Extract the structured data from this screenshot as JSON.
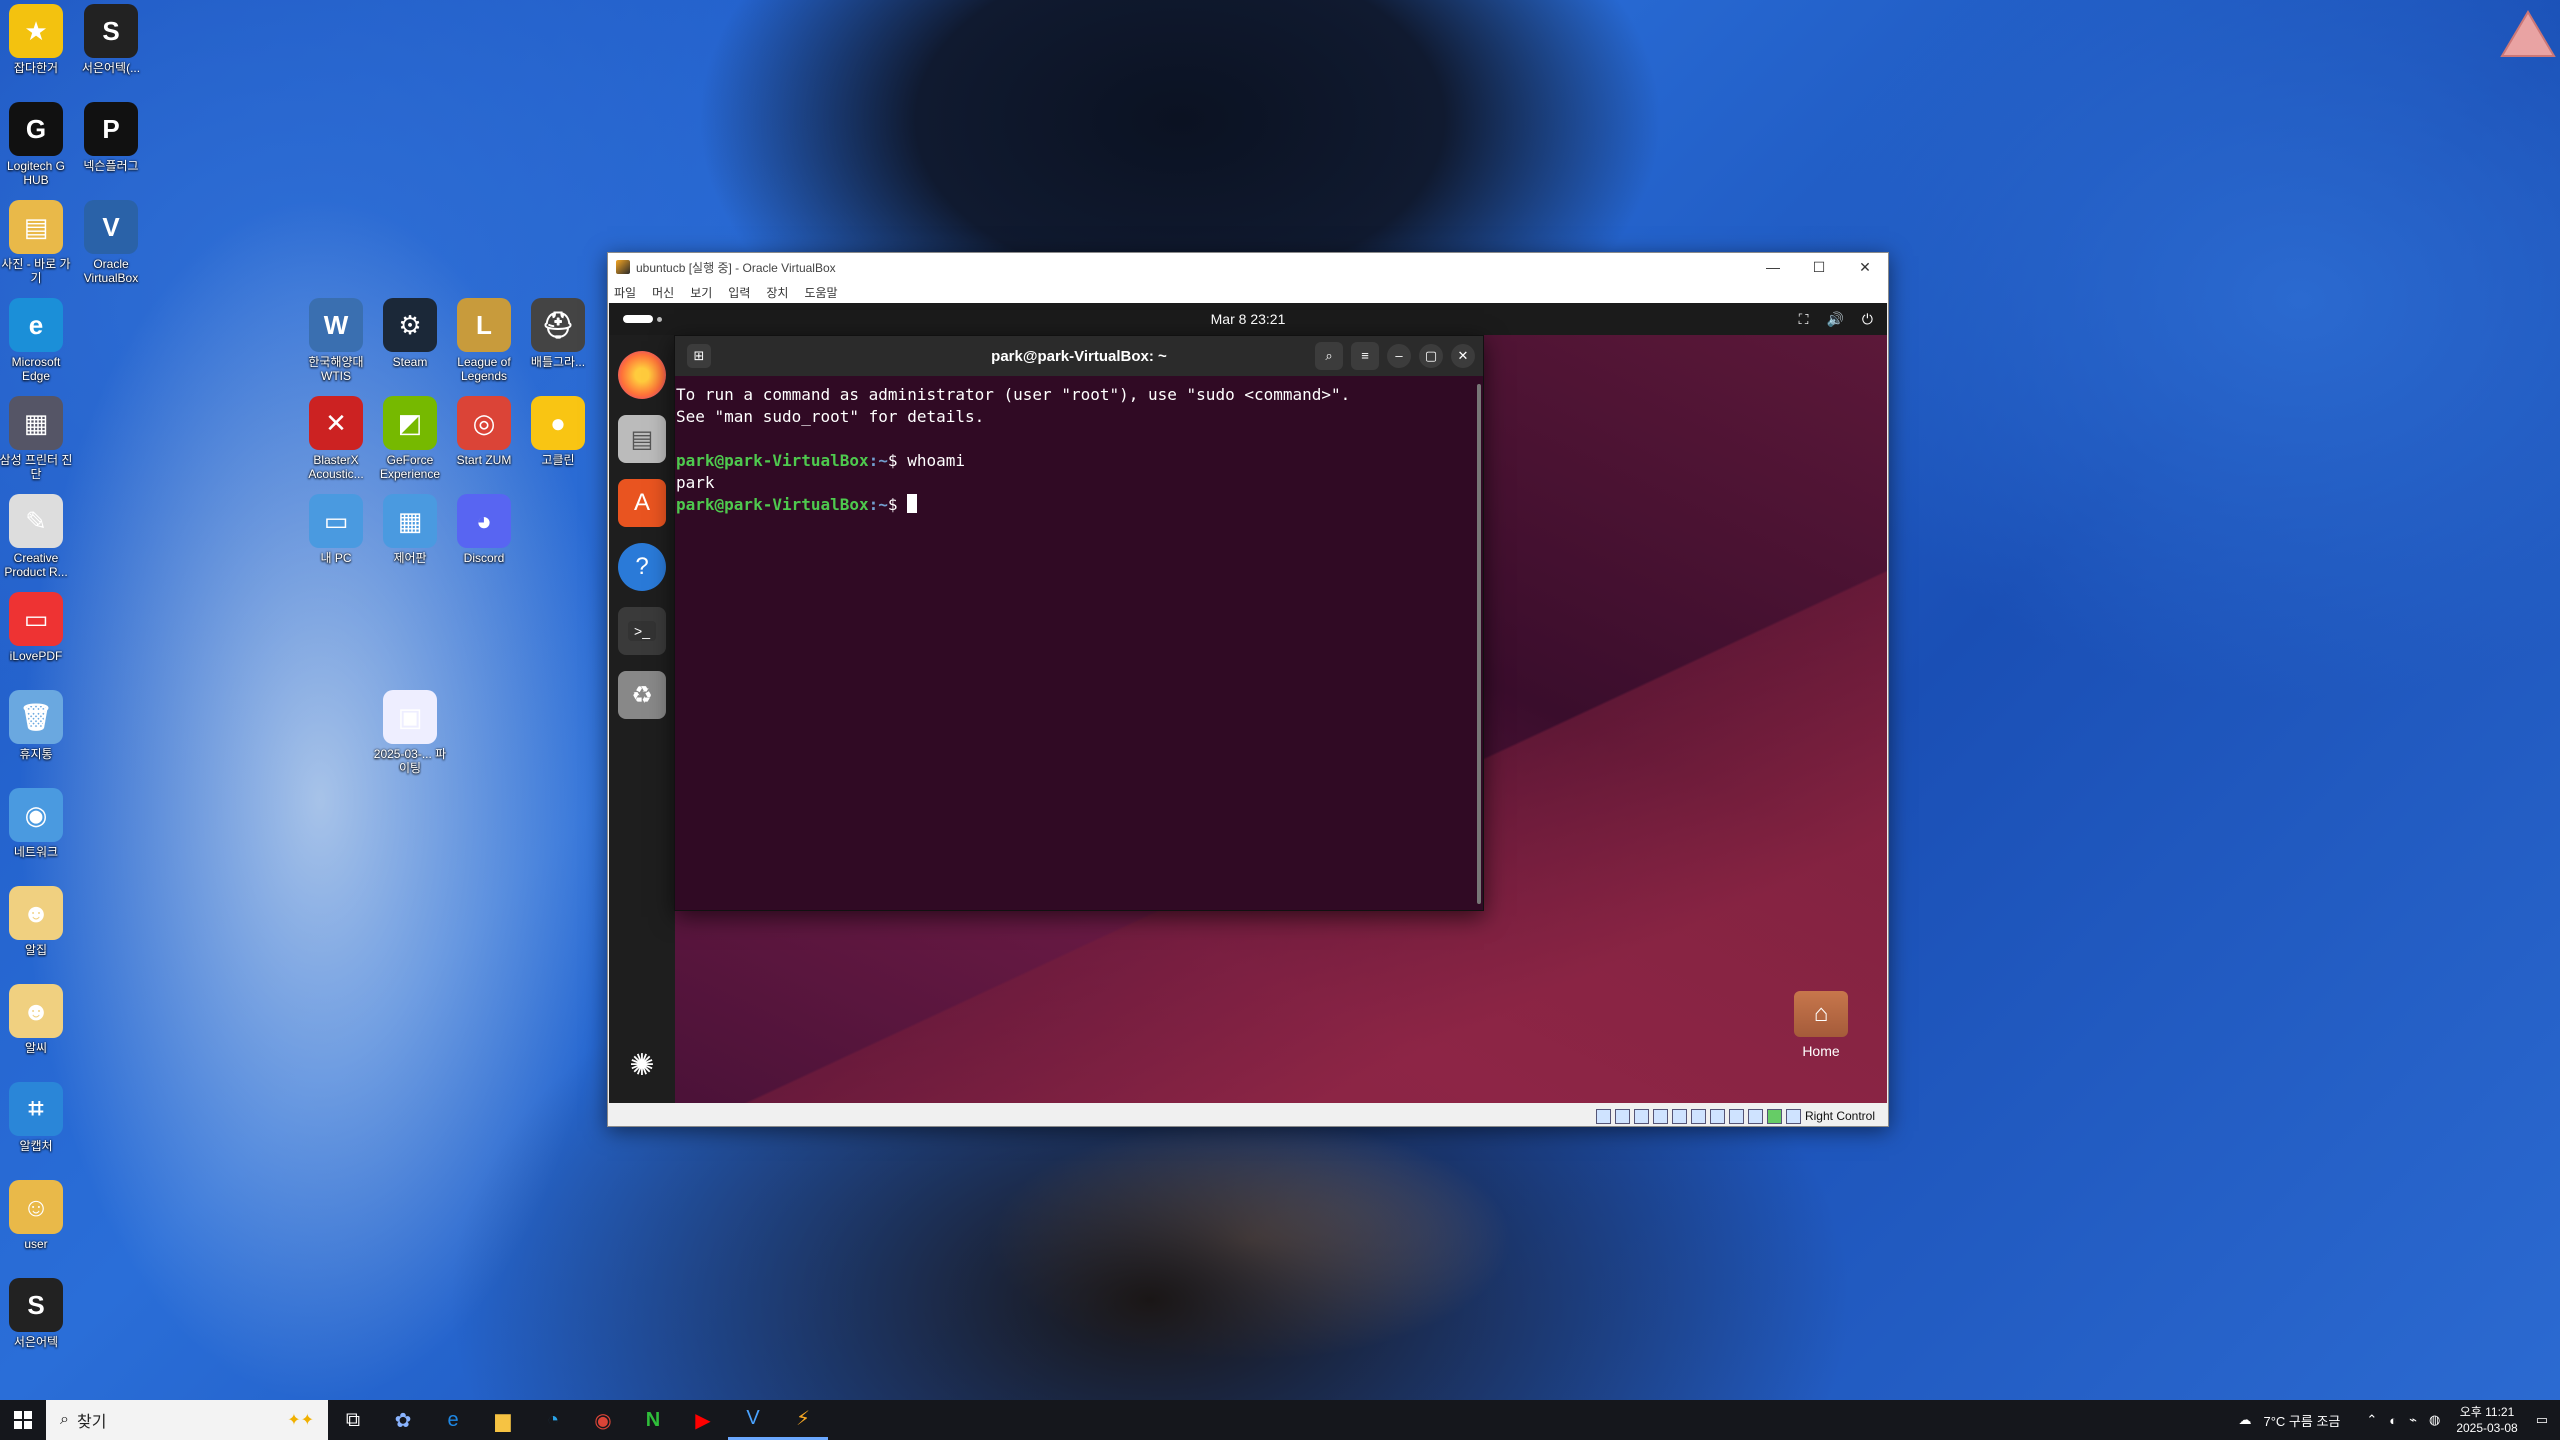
{
  "desktop": {
    "icons": [
      {
        "id": "favorites",
        "label": "잡다한거",
        "glyph": "★",
        "color": "#f3c20f"
      },
      {
        "id": "seoeun1",
        "label": "서은어텍(...",
        "glyph": "S",
        "color": "#222"
      },
      {
        "id": "logitech",
        "label": "Logitech G HUB",
        "glyph": "G",
        "color": "#111"
      },
      {
        "id": "nexon",
        "label": "넥슨플러그",
        "glyph": "P",
        "color": "#111"
      },
      {
        "id": "photos",
        "label": "사진 - 바로 가기",
        "glyph": "▤",
        "color": "#e9b949"
      },
      {
        "id": "virtualbox",
        "label": "Oracle VirtualBox",
        "glyph": "V",
        "color": "#2a62a8"
      },
      {
        "id": "edge",
        "label": "Microsoft Edge",
        "glyph": "e",
        "color": "#1b8fd8"
      },
      {
        "id": "samsung",
        "label": "삼성 프린터 진단",
        "glyph": "▦",
        "color": "#556"
      },
      {
        "id": "creative",
        "label": "Creative Product R...",
        "glyph": "✎",
        "color": "#ddd"
      },
      {
        "id": "ilovepdf",
        "label": "iLovePDF",
        "glyph": "▭",
        "color": "#e33"
      },
      {
        "id": "trash",
        "label": "휴지통",
        "glyph": "🗑",
        "color": "#6aa8e0"
      },
      {
        "id": "network",
        "label": "네트워크",
        "glyph": "◉",
        "color": "#4a9ae0"
      },
      {
        "id": "alzip",
        "label": "알집",
        "glyph": "☻",
        "color": "#f0d080"
      },
      {
        "id": "alsee",
        "label": "알씨",
        "glyph": "☻",
        "color": "#f0d080"
      },
      {
        "id": "alcapture",
        "label": "알캡처",
        "glyph": "⌗",
        "color": "#2a86d8"
      },
      {
        "id": "user",
        "label": "user",
        "glyph": "☺",
        "color": "#e9b949"
      },
      {
        "id": "seoeun2",
        "label": "서은어텍",
        "glyph": "S",
        "color": "#222"
      },
      {
        "id": "wtis",
        "label": "한국해양대 WTIS",
        "glyph": "W",
        "color": "#3a6fb0"
      },
      {
        "id": "steam",
        "label": "Steam",
        "glyph": "⚙",
        "color": "#1b2838"
      },
      {
        "id": "lol",
        "label": "League of Legends",
        "glyph": "L",
        "color": "#c89b3c"
      },
      {
        "id": "pubg",
        "label": "배틀그라...",
        "glyph": "⛑",
        "color": "#444"
      },
      {
        "id": "blasterx",
        "label": "BlasterX Acoustic...",
        "glyph": "✕",
        "color": "#c22"
      },
      {
        "id": "geforce",
        "label": "GeForce Experience",
        "glyph": "◩",
        "color": "#76b900"
      },
      {
        "id": "zum",
        "label": "Start ZUM",
        "glyph": "◎",
        "color": "#db4437"
      },
      {
        "id": "gostop",
        "label": "고클린",
        "glyph": "●",
        "color": "#f9c513"
      },
      {
        "id": "mypc",
        "label": "내 PC",
        "glyph": "▭",
        "color": "#4a9ae0"
      },
      {
        "id": "control",
        "label": "제어판",
        "glyph": "▦",
        "color": "#4a9ae0"
      },
      {
        "id": "discord",
        "label": "Discord",
        "glyph": "◕",
        "color": "#5865f2"
      },
      {
        "id": "imagefile",
        "label": "2025-03-... 파이팅",
        "glyph": "▣",
        "color": "#eef"
      }
    ]
  },
  "vbox": {
    "title": "ubuntucb [실행 중] - Oracle VirtualBox",
    "menu": [
      "파일",
      "머신",
      "보기",
      "입력",
      "장치",
      "도움말"
    ],
    "status_host_key": "Right Control"
  },
  "guest": {
    "clock": "Mar 8  23:21",
    "terminal": {
      "title": "park@park-VirtualBox: ~",
      "lines": {
        "l1": "To run a command as administrator (user \"root\"), use \"sudo <command>\".",
        "l2": "See \"man sudo_root\" for details.",
        "p1_user": "park@park-VirtualBox",
        "p1_path": ":~",
        "p1_cmd": "$ whoami",
        "out1": "park",
        "p2_user": "park@park-VirtualBox",
        "p2_path": ":~",
        "p2_cmd": "$ "
      }
    },
    "home_label": "Home"
  },
  "taskbar": {
    "search_placeholder": "찾기",
    "weather": "7°C  구름 조금",
    "time": "오후 11:21",
    "date": "2025-03-08"
  }
}
